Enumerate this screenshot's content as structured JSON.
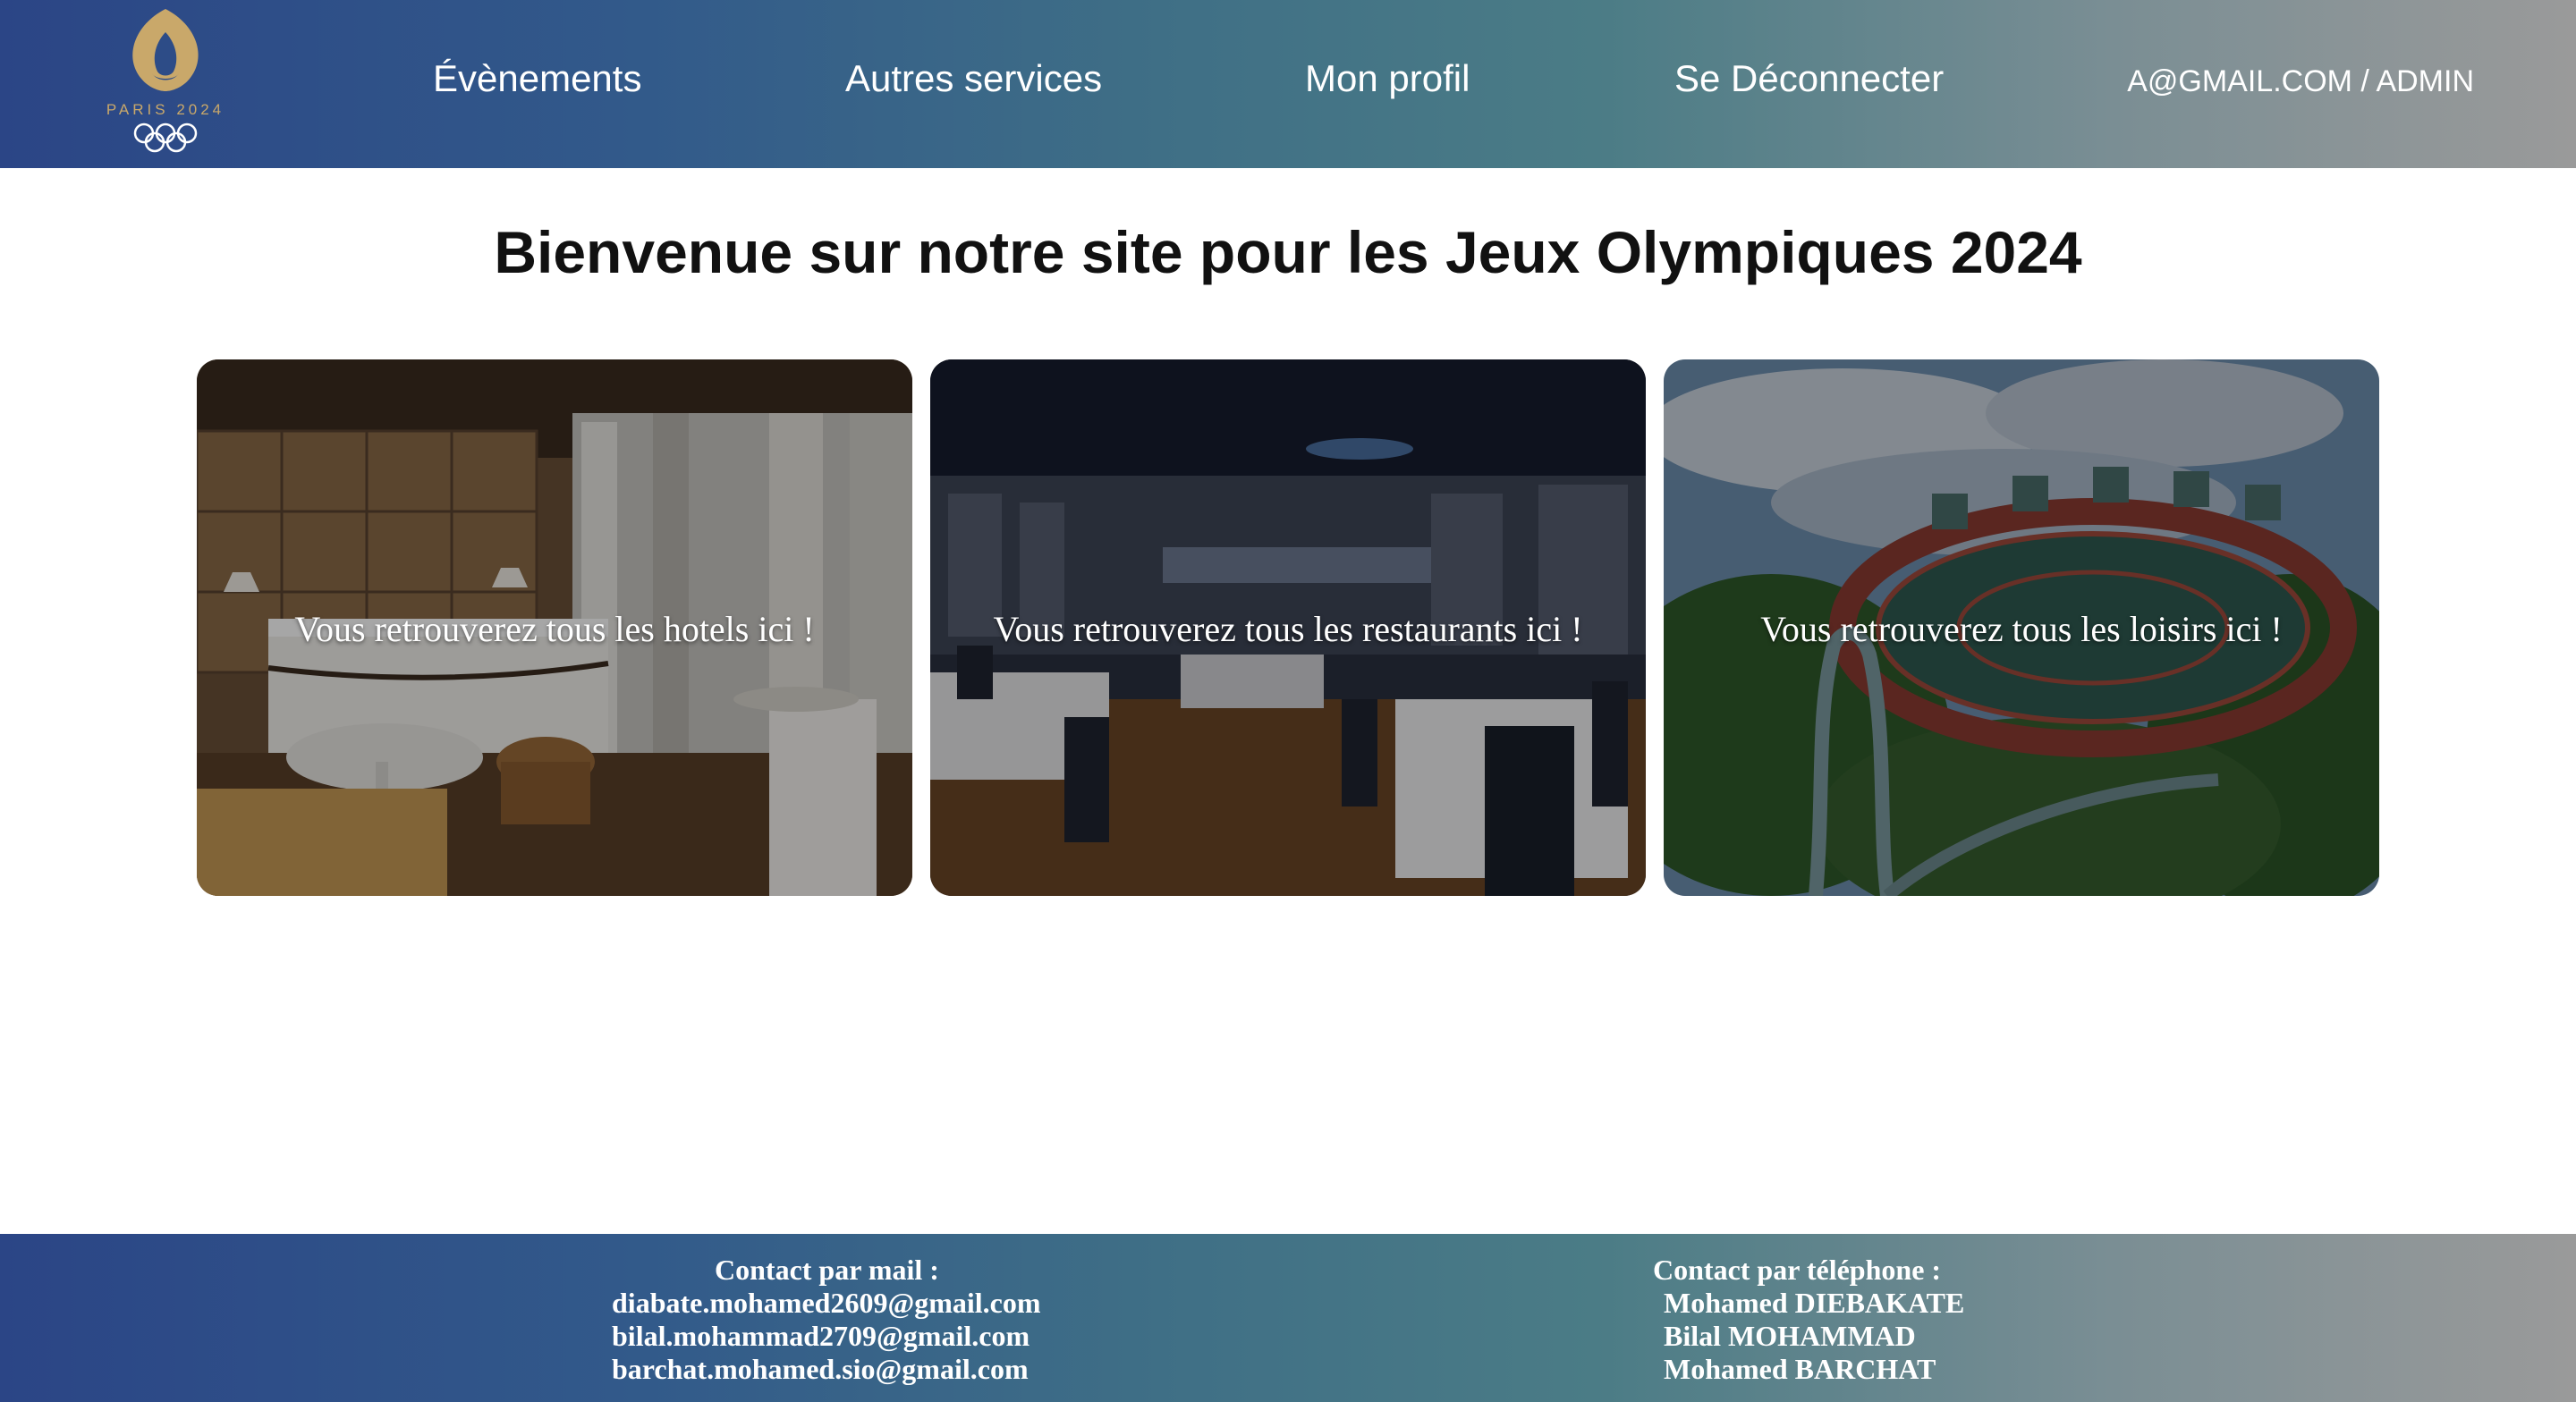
{
  "header": {
    "logo": {
      "text": "PARIS 2024",
      "icon": "olympic-flame-rings-logo",
      "color": "#c9a86a"
    },
    "nav": [
      {
        "label": "Évènements"
      },
      {
        "label": "Autres services"
      },
      {
        "label": "Mon profil"
      },
      {
        "label": "Se Déconnecter"
      }
    ],
    "user_label": "A@GMAIL.COM / ADMIN"
  },
  "main": {
    "title": "Bienvenue sur notre site pour les Jeux Olympiques 2024",
    "cards": [
      {
        "text": "Vous retrouverez tous les hotels ici !",
        "image": "hotel-room-photo"
      },
      {
        "text": "Vous retrouverez tous les restaurants ici !",
        "image": "restaurant-interior-photo"
      },
      {
        "text": "Vous retrouverez tous les loisirs ici !",
        "image": "amusement-ride-photo"
      }
    ]
  },
  "footer": {
    "mail": {
      "heading": "Contact par mail :",
      "lines": [
        "diabate.mohamed2609@gmail.com",
        "bilal.mohammad2709@gmail.com",
        "barchat.mohamed.sio@gmail.com"
      ]
    },
    "phone": {
      "heading": "Contact par téléphone :",
      "lines": [
        "Mohamed DIEBAKATE",
        "Bilal MOHAMMAD",
        "Mohamed BARCHAT"
      ]
    }
  },
  "colors": {
    "gradient_start": "#2b4586",
    "gradient_end": "#9a9a9a",
    "gold": "#c9a86a"
  }
}
